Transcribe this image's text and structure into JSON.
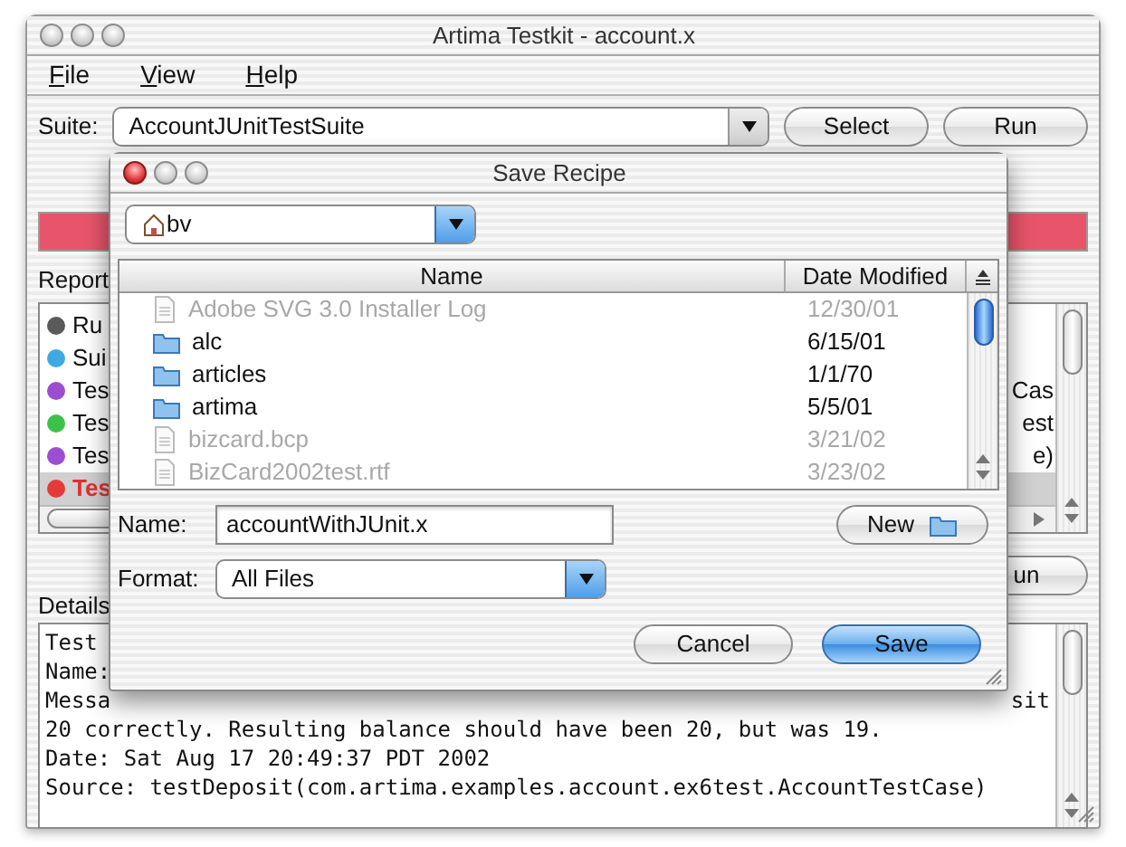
{
  "main_window": {
    "title": "Artima Testkit - account.x",
    "menu": [
      {
        "label": "File"
      },
      {
        "label": "View"
      },
      {
        "label": "Help"
      }
    ],
    "suite": {
      "label": "Suite:",
      "value": "AccountJUnitTestSuite"
    },
    "top_buttons": [
      "Select",
      "Run"
    ],
    "progress": {
      "level": 1
    },
    "reports": {
      "label": "Report",
      "items": [
        {
          "text": "Ru",
          "color": "#5a5a5a",
          "selected": false,
          "failed": false
        },
        {
          "text": "Sui",
          "color": "#3fa9e0",
          "selected": false,
          "failed": false
        },
        {
          "text": "Tes",
          "tail": "Cas",
          "color": "#9b4fd0",
          "selected": false,
          "failed": false
        },
        {
          "text": "Tes",
          "tail": "est",
          "color": "#3cc24a",
          "selected": false,
          "failed": false
        },
        {
          "text": "Tes",
          "tail": "e)",
          "color": "#9b4fd0",
          "selected": false,
          "failed": false
        },
        {
          "text": "Tes",
          "color": "#e53a3a",
          "selected": true,
          "failed": true
        }
      ]
    },
    "run_button": "un",
    "details": {
      "label": "Details",
      "lines": [
        {
          "text": "Test"
        },
        {
          "text": "Name:"
        },
        {
          "text": "Messa",
          "tail": "sit"
        },
        {
          "text": "20 correctly. Resulting balance should have been 20, but was 19."
        },
        {
          "text": "Date: Sat Aug 17 20:49:37 PDT 2002"
        },
        {
          "text": "Source: testDeposit(com.artima.examples.account.ex6test.AccountTestCase)"
        }
      ]
    }
  },
  "dialog": {
    "title": "Save Recipe",
    "location": "bv",
    "columns": [
      {
        "label": "Name"
      },
      {
        "label": "Date Modified"
      }
    ],
    "files": [
      {
        "name": "Adobe SVG 3.0 Installer Log",
        "date": "12/30/01",
        "kind": "document",
        "enabled": false
      },
      {
        "name": "alc",
        "date": "6/15/01",
        "kind": "folder",
        "enabled": true
      },
      {
        "name": "articles",
        "date": "1/1/70",
        "kind": "folder",
        "enabled": true
      },
      {
        "name": "artima",
        "date": "5/5/01",
        "kind": "folder",
        "enabled": true
      },
      {
        "name": "bizcard.bcp",
        "date": "3/21/02",
        "kind": "document",
        "enabled": false
      },
      {
        "name": "BizCard2002test.rtf",
        "date": "3/23/02",
        "kind": "document",
        "enabled": false
      }
    ],
    "name_field": {
      "label": "Name:",
      "value": "accountWithJUnit.x"
    },
    "new_button": "New",
    "format": {
      "label": "Format:",
      "value": "All Files"
    },
    "buttons": [
      {
        "label": "Cancel",
        "default": false
      },
      {
        "label": "Save",
        "default": true
      }
    ]
  }
}
